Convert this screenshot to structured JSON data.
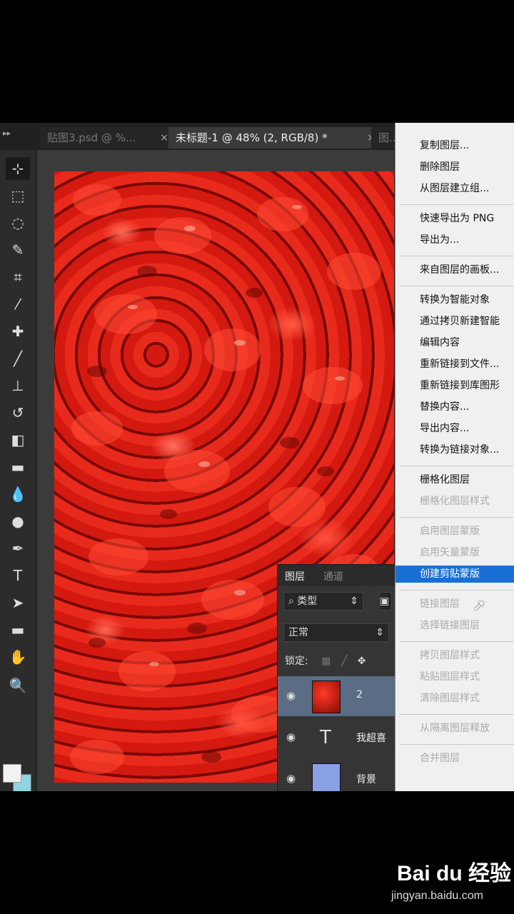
{
  "tabs": {
    "tab1_label": "贴图3.psd @ %...",
    "tab2_label": "未标题-1 @ 48% (2, RGB/8) *",
    "tab3_label": "图..."
  },
  "toolbox": {
    "tools": [
      "move-icon",
      "marquee-icon",
      "lasso-icon",
      "quick-select-icon",
      "crop-icon",
      "eyedropper-icon",
      "healing-icon",
      "brush-icon",
      "stamp-icon",
      "history-brush-icon",
      "eraser-icon",
      "gradient-icon",
      "blur-icon",
      "dodge-icon",
      "pen-icon",
      "type-icon",
      "path-select-icon",
      "rectangle-icon",
      "hand-icon",
      "zoom-icon"
    ],
    "foreground_color": "#f2f2f2",
    "background_color": "#8fd4e0"
  },
  "layers_panel": {
    "tab_layers": "图层",
    "tab_channels": "通道",
    "filter_label": "类型",
    "blend_mode": "正常",
    "lock_label": "锁定:",
    "layers": [
      {
        "name": "2",
        "selected": true
      },
      {
        "name": "我超喜",
        "selected": false
      },
      {
        "name": "背景",
        "selected": false
      }
    ]
  },
  "context_menu": {
    "groups": [
      [
        "复制图层...",
        "删除图层",
        "从图层建立组..."
      ],
      [
        "快速导出为 PNG",
        "导出为..."
      ],
      [
        "来自图层的画板..."
      ],
      [
        "转换为智能对象",
        "通过拷贝新建智能",
        "编辑内容",
        "重新链接到文件...",
        "重新链接到库图形",
        "替换内容...",
        "导出内容...",
        "转换为链接对象..."
      ],
      [
        "栅格化图层",
        "栅格化图层样式"
      ],
      [
        "启用图层蒙版",
        "启用矢量蒙版",
        "创建剪贴蒙版"
      ],
      [
        "链接图层",
        "选择链接图层"
      ],
      [
        "拷贝图层样式",
        "粘贴图层样式",
        "清除图层样式"
      ],
      [
        "从隔离图层释放"
      ],
      [
        "合并图层"
      ]
    ],
    "disabled": [
      "栅格化图层样式",
      "启用图层蒙版",
      "启用矢量蒙版",
      "链接图层",
      "选择链接图层",
      "拷贝图层样式",
      "粘贴图层样式",
      "清除图层样式",
      "从隔离图层释放",
      "合并图层"
    ],
    "highlighted": "创建剪贴蒙版"
  },
  "watermark": {
    "brand": "Bai du 经验",
    "url": "jingyan.baidu.com"
  }
}
